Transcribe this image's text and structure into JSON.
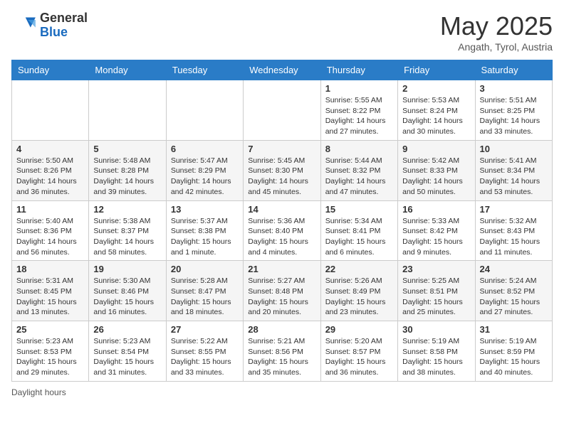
{
  "header": {
    "logo_general": "General",
    "logo_blue": "Blue",
    "month_title": "May 2025",
    "location": "Angath, Tyrol, Austria"
  },
  "weekdays": [
    "Sunday",
    "Monday",
    "Tuesday",
    "Wednesday",
    "Thursday",
    "Friday",
    "Saturday"
  ],
  "weeks": [
    [
      {
        "day": "",
        "info": ""
      },
      {
        "day": "",
        "info": ""
      },
      {
        "day": "",
        "info": ""
      },
      {
        "day": "",
        "info": ""
      },
      {
        "day": "1",
        "info": "Sunrise: 5:55 AM\nSunset: 8:22 PM\nDaylight: 14 hours and 27 minutes."
      },
      {
        "day": "2",
        "info": "Sunrise: 5:53 AM\nSunset: 8:24 PM\nDaylight: 14 hours and 30 minutes."
      },
      {
        "day": "3",
        "info": "Sunrise: 5:51 AM\nSunset: 8:25 PM\nDaylight: 14 hours and 33 minutes."
      }
    ],
    [
      {
        "day": "4",
        "info": "Sunrise: 5:50 AM\nSunset: 8:26 PM\nDaylight: 14 hours and 36 minutes."
      },
      {
        "day": "5",
        "info": "Sunrise: 5:48 AM\nSunset: 8:28 PM\nDaylight: 14 hours and 39 minutes."
      },
      {
        "day": "6",
        "info": "Sunrise: 5:47 AM\nSunset: 8:29 PM\nDaylight: 14 hours and 42 minutes."
      },
      {
        "day": "7",
        "info": "Sunrise: 5:45 AM\nSunset: 8:30 PM\nDaylight: 14 hours and 45 minutes."
      },
      {
        "day": "8",
        "info": "Sunrise: 5:44 AM\nSunset: 8:32 PM\nDaylight: 14 hours and 47 minutes."
      },
      {
        "day": "9",
        "info": "Sunrise: 5:42 AM\nSunset: 8:33 PM\nDaylight: 14 hours and 50 minutes."
      },
      {
        "day": "10",
        "info": "Sunrise: 5:41 AM\nSunset: 8:34 PM\nDaylight: 14 hours and 53 minutes."
      }
    ],
    [
      {
        "day": "11",
        "info": "Sunrise: 5:40 AM\nSunset: 8:36 PM\nDaylight: 14 hours and 56 minutes."
      },
      {
        "day": "12",
        "info": "Sunrise: 5:38 AM\nSunset: 8:37 PM\nDaylight: 14 hours and 58 minutes."
      },
      {
        "day": "13",
        "info": "Sunrise: 5:37 AM\nSunset: 8:38 PM\nDaylight: 15 hours and 1 minute."
      },
      {
        "day": "14",
        "info": "Sunrise: 5:36 AM\nSunset: 8:40 PM\nDaylight: 15 hours and 4 minutes."
      },
      {
        "day": "15",
        "info": "Sunrise: 5:34 AM\nSunset: 8:41 PM\nDaylight: 15 hours and 6 minutes."
      },
      {
        "day": "16",
        "info": "Sunrise: 5:33 AM\nSunset: 8:42 PM\nDaylight: 15 hours and 9 minutes."
      },
      {
        "day": "17",
        "info": "Sunrise: 5:32 AM\nSunset: 8:43 PM\nDaylight: 15 hours and 11 minutes."
      }
    ],
    [
      {
        "day": "18",
        "info": "Sunrise: 5:31 AM\nSunset: 8:45 PM\nDaylight: 15 hours and 13 minutes."
      },
      {
        "day": "19",
        "info": "Sunrise: 5:30 AM\nSunset: 8:46 PM\nDaylight: 15 hours and 16 minutes."
      },
      {
        "day": "20",
        "info": "Sunrise: 5:28 AM\nSunset: 8:47 PM\nDaylight: 15 hours and 18 minutes."
      },
      {
        "day": "21",
        "info": "Sunrise: 5:27 AM\nSunset: 8:48 PM\nDaylight: 15 hours and 20 minutes."
      },
      {
        "day": "22",
        "info": "Sunrise: 5:26 AM\nSunset: 8:49 PM\nDaylight: 15 hours and 23 minutes."
      },
      {
        "day": "23",
        "info": "Sunrise: 5:25 AM\nSunset: 8:51 PM\nDaylight: 15 hours and 25 minutes."
      },
      {
        "day": "24",
        "info": "Sunrise: 5:24 AM\nSunset: 8:52 PM\nDaylight: 15 hours and 27 minutes."
      }
    ],
    [
      {
        "day": "25",
        "info": "Sunrise: 5:23 AM\nSunset: 8:53 PM\nDaylight: 15 hours and 29 minutes."
      },
      {
        "day": "26",
        "info": "Sunrise: 5:23 AM\nSunset: 8:54 PM\nDaylight: 15 hours and 31 minutes."
      },
      {
        "day": "27",
        "info": "Sunrise: 5:22 AM\nSunset: 8:55 PM\nDaylight: 15 hours and 33 minutes."
      },
      {
        "day": "28",
        "info": "Sunrise: 5:21 AM\nSunset: 8:56 PM\nDaylight: 15 hours and 35 minutes."
      },
      {
        "day": "29",
        "info": "Sunrise: 5:20 AM\nSunset: 8:57 PM\nDaylight: 15 hours and 36 minutes."
      },
      {
        "day": "30",
        "info": "Sunrise: 5:19 AM\nSunset: 8:58 PM\nDaylight: 15 hours and 38 minutes."
      },
      {
        "day": "31",
        "info": "Sunrise: 5:19 AM\nSunset: 8:59 PM\nDaylight: 15 hours and 40 minutes."
      }
    ]
  ],
  "footer": {
    "daylight_label": "Daylight hours"
  }
}
